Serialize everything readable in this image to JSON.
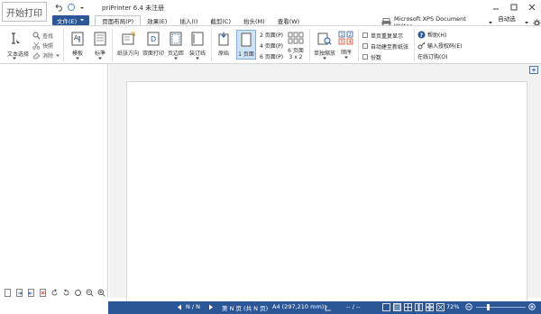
{
  "app": {
    "logo_text": "开始打印",
    "title": "priPrinter 6.4 未注册"
  },
  "menu": {
    "file": "文件(E)",
    "tabs": [
      "页面布局(P)",
      "效果(E)",
      "插入(I)",
      "截剪(C)",
      "抬头(M)",
      "查看(W)"
    ]
  },
  "printer": {
    "name": "Microsoft XPS Document Writer",
    "auto_select": "自动选择"
  },
  "ribbon": {
    "text_select": "文本选择",
    "search": "查找",
    "snapshot": "快照",
    "eraser": "消除",
    "template": "模板",
    "mark": "标準",
    "paper_direction": "纸张方向",
    "duplex": "双面打印",
    "margins": "页边距",
    "binding": "装订线",
    "original": "原始",
    "one_page": "1 页面",
    "two_page": "2 页面(P)",
    "four_page": "4 页面(P)",
    "six_page": "6 页面(P)",
    "six_grid": "6 页面",
    "grid_size": "3 x 2",
    "single_zoom": "单独缩放",
    "order": "顺序",
    "chk_single_repeat": "单页重复显示",
    "chk_auto_new": "自动建至新纸张",
    "chk_copies": "份数",
    "help": "帮助(H)",
    "license": "输入授权码(E)",
    "online": "在线订购(O)"
  },
  "status": {
    "nav": "N / N",
    "page_info": "第 N 页 (共 N 页)",
    "paper": "A4 (297,210 mm)",
    "dashes": "-- / --",
    "zoom": "72%"
  }
}
